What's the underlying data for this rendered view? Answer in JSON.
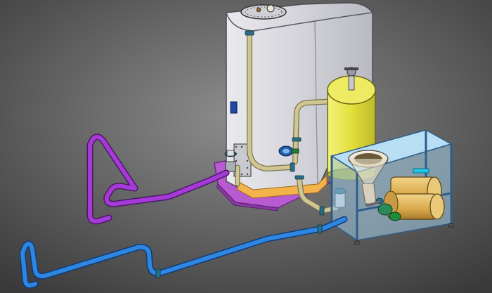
{
  "scene": {
    "background_gradient": [
      "#8a8a8a",
      "#3c3c3c"
    ],
    "colors": {
      "tank_body": "#d8d8dc",
      "tank_shadow": "#b8b8c0",
      "tank_band": "#f3b24a",
      "tank_base": "#c76bd8",
      "cylinder_yellow": "#e6e24a",
      "frame_blue": "#a9d3ee",
      "frame_edge": "#2e5d8a",
      "pipe_tan": "#c7bf8a",
      "pipe_purple": "#a33bd6",
      "pipe_blue": "#2f86e0",
      "pump_gold": "#e0b85e",
      "valve_teal": "#2a6f86",
      "accent_green": "#1e8a3a"
    }
  }
}
